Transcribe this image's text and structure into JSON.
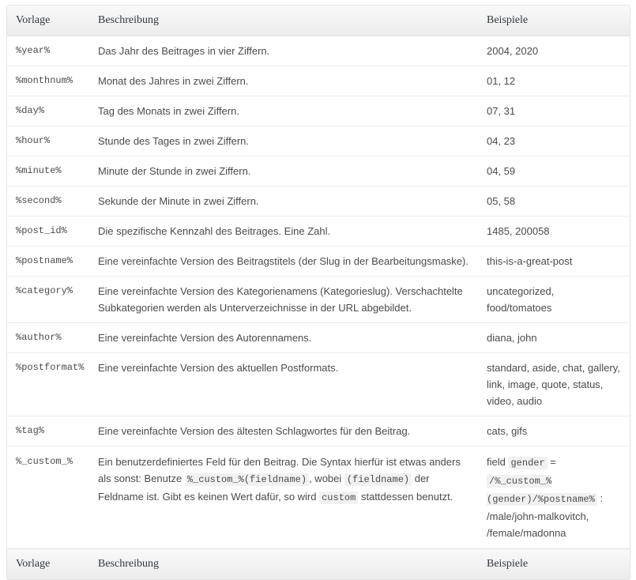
{
  "table": {
    "columns": [
      {
        "key": "vorlage",
        "label": "Vorlage"
      },
      {
        "key": "beschreibung",
        "label": "Beschreibung"
      },
      {
        "key": "beispiele",
        "label": "Beispiele"
      }
    ],
    "header": {
      "vorlage": "Vorlage",
      "beschreibung": "Beschreibung",
      "beispiele": "Beispiele"
    },
    "footer": {
      "vorlage": "Vorlage",
      "beschreibung": "Beschreibung",
      "beispiele": "Beispiele"
    },
    "rows": [
      {
        "vorlage": "%year%",
        "beschreibung": "Das Jahr des Beitrages in vier Ziffern.",
        "beispiele": "2004, 2020"
      },
      {
        "vorlage": "%monthnum%",
        "beschreibung": "Monat des Jahres in zwei Ziffern.",
        "beispiele": "01, 12"
      },
      {
        "vorlage": "%day%",
        "beschreibung": "Tag des Monats in zwei Ziffern.",
        "beispiele": "07, 31"
      },
      {
        "vorlage": "%hour%",
        "beschreibung": "Stunde des Tages in zwei Ziffern.",
        "beispiele": "04, 23"
      },
      {
        "vorlage": "%minute%",
        "beschreibung": "Minute der Stunde in zwei Ziffern.",
        "beispiele": "04, 59"
      },
      {
        "vorlage": "%second%",
        "beschreibung": "Sekunde der Minute in zwei Ziffern.",
        "beispiele": "05, 58"
      },
      {
        "vorlage": "%post_id%",
        "beschreibung": "Die spezifische Kennzahl des Beitrages. Eine Zahl.",
        "beispiele": "1485, 200058"
      },
      {
        "vorlage": "%postname%",
        "beschreibung": "Eine vereinfachte Version des Beitragstitels (der Slug in der Bearbeitungsmaske).",
        "beispiele": "this-is-a-great-post"
      },
      {
        "vorlage": "%category%",
        "beschreibung": "Eine vereinfachte Version des Kategorienamens (Kategorieslug). Verschachtelte Subkategorien werden als Unterverzeichnisse in der URL abgebildet.",
        "beispiele": "uncategorized, food/tomatoes"
      },
      {
        "vorlage": "%author%",
        "beschreibung": "Eine vereinfachte Version des Autorennamens.",
        "beispiele": "diana, john"
      },
      {
        "vorlage": "%postformat%",
        "beschreibung": "Eine vereinfachte Version des aktuellen Postformats.",
        "beispiele": "standard, aside, chat, gallery, link, image, quote, status, video, audio"
      },
      {
        "vorlage": "%tag%",
        "beschreibung": "Eine vereinfachte Version des ältesten Schlagwortes für den Beitrag.",
        "beispiele": "cats, gifs"
      }
    ],
    "custom_row": {
      "vorlage": "%_custom_%",
      "beschreibung_part1": "Ein benutzerdefiniertes Feld für den Beitrag. Die Syntax hierfür ist etwas anders als sonst: Benutze ",
      "beschreibung_code1": "%_custom_%(fieldname)",
      "beschreibung_part2": ", wobei ",
      "beschreibung_code2": "(fieldname)",
      "beschreibung_part3": " der Feldname ist. Gibt es keinen Wert dafür, so wird ",
      "beschreibung_code3": "custom",
      "beschreibung_part4": " stattdessen benutzt.",
      "beispiele_part1": "field ",
      "beispiele_code1": "gender",
      "beispiele_part2": " = ",
      "beispiele_code2": "/%_custom_%(gender)/%postname%",
      "beispiele_part3": " : /male/john-malkovitch, /female/madonna"
    }
  },
  "colors": {
    "border": "#e5e5e5",
    "row_border": "#ededed",
    "header_bg_top": "#f9f9f9",
    "header_bg_bottom": "#ececec",
    "text": "#4b4b4b",
    "heading_text": "#32373c",
    "code_bg": "#f1f1f1"
  }
}
